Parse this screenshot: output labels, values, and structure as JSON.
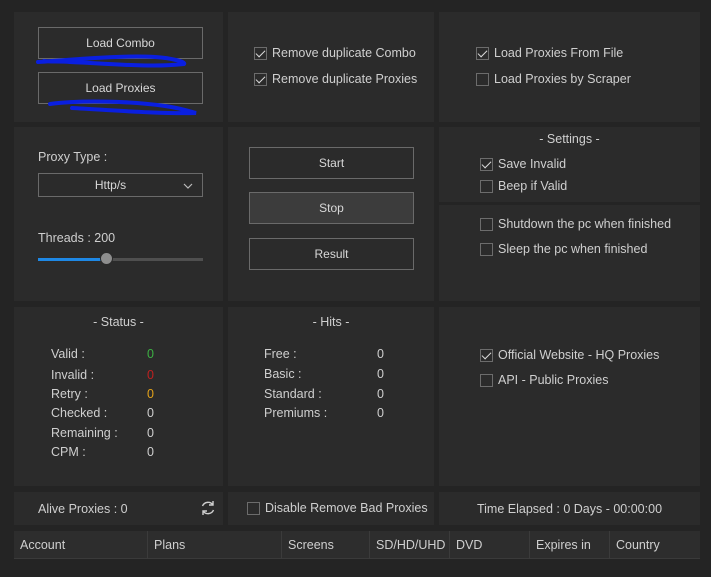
{
  "loader": {
    "load_combo": "Load Combo",
    "load_proxies": "Load Proxies"
  },
  "dedupe": {
    "remove_combo": "Remove duplicate Combo",
    "remove_proxies": "Remove duplicate Proxies"
  },
  "proxy_source": {
    "from_file": "Load Proxies From File",
    "by_scraper": "Load Proxies by Scraper"
  },
  "proxy_config": {
    "type_label": "Proxy Type :",
    "type_value": "Http/s",
    "threads_label": "Threads : 200",
    "threads_fraction": 0.41
  },
  "controls": {
    "start": "Start",
    "stop": "Stop",
    "result": "Result"
  },
  "settings": {
    "title": "-  Settings  -",
    "save_invalid": "Save Invalid",
    "beep_valid": "Beep if Valid",
    "shutdown": "Shutdown the pc when finished",
    "sleep": "Sleep the pc when finished"
  },
  "status": {
    "title": "-  Status  -",
    "rows": [
      {
        "label": "Valid :",
        "value": "0",
        "color": "#3cb043"
      },
      {
        "label": "Invalid :",
        "value": "0",
        "color": "#c02020"
      },
      {
        "label": "Retry :",
        "value": "0",
        "color": "#e3a21a"
      },
      {
        "label": "Checked :",
        "value": "0",
        "color": "#cfcfcf"
      },
      {
        "label": "Remaining :",
        "value": "0",
        "color": "#cfcfcf"
      },
      {
        "label": "CPM :",
        "value": "0",
        "color": "#cfcfcf"
      }
    ]
  },
  "hits": {
    "title": "-  Hits  -",
    "rows": [
      {
        "label": "Free :",
        "value": "0"
      },
      {
        "label": "Basic :",
        "value": "0"
      },
      {
        "label": "Standard :",
        "value": "0"
      },
      {
        "label": "Premiums :",
        "value": "0"
      }
    ]
  },
  "proxy_api": {
    "official": "Official Website - HQ Proxies",
    "public": "API - Public Proxies"
  },
  "footer": {
    "alive_proxies": "Alive Proxies : 0",
    "disable_remove_bad": "Disable Remove Bad Proxies",
    "time_elapsed": "Time Elapsed : 0 Days - 00:00:00"
  },
  "table": {
    "columns": [
      "Account",
      "Plans",
      "Screens",
      "SD/HD/UHD",
      "DVD",
      "Expires in",
      "Country"
    ]
  },
  "colors": {
    "accent_slider": "#1e88e5",
    "annotation": "#0a1fe0"
  },
  "icons": [
    "chevron-down-icon",
    "refresh-icon",
    "check-icon"
  ]
}
